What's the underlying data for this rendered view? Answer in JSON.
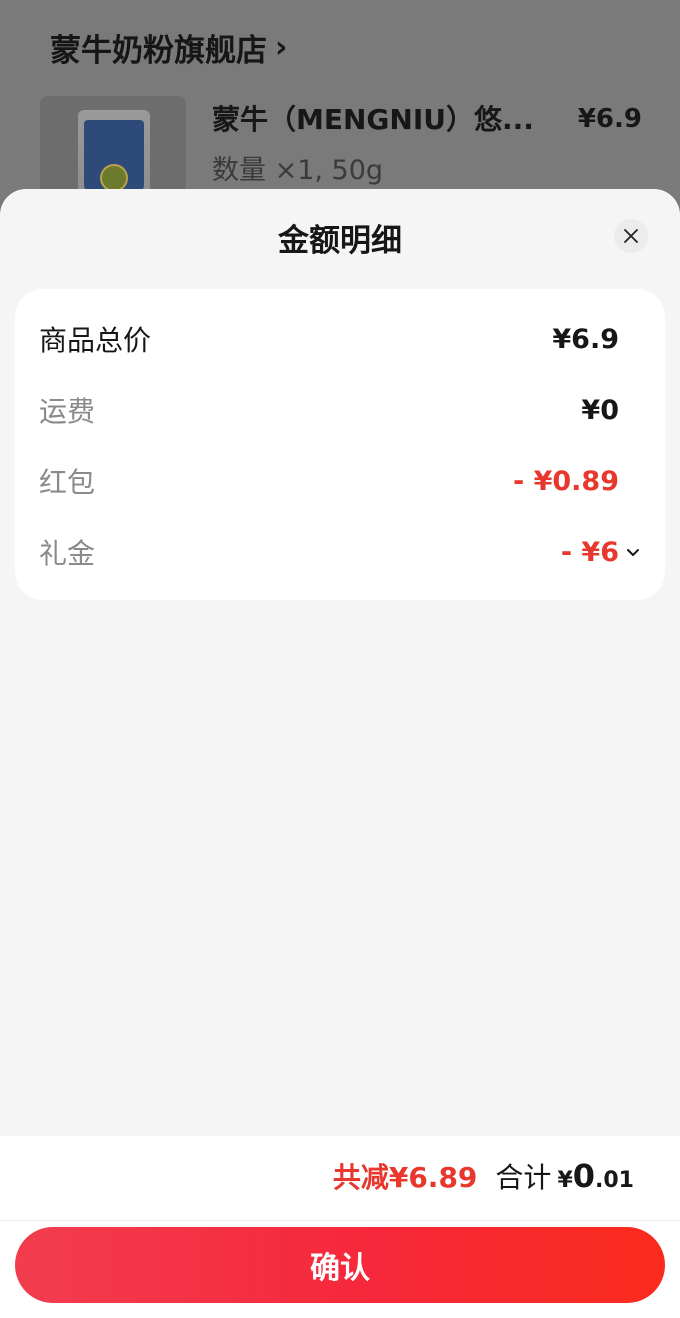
{
  "background_page": {
    "store_name": "蒙牛奶粉旗舰店",
    "product": {
      "title": "蒙牛（MENGNIU）悠...",
      "price": "¥6.9",
      "meta": "数量 ×1, 50g"
    }
  },
  "sheet": {
    "title": "金额明细",
    "rows": [
      {
        "label": "商品总价",
        "value": "¥6.9"
      },
      {
        "label": "运费",
        "value": "¥0"
      },
      {
        "label": "红包",
        "value": "- ¥0.89"
      },
      {
        "label": "礼金",
        "value": "- ¥6"
      }
    ]
  },
  "footer": {
    "saved_label": "共减",
    "saved_amount": "¥6.89",
    "total_label": "合计",
    "total_yen": "¥",
    "total_int": "0",
    "total_dec": ".01",
    "confirm_label": "确认"
  },
  "colors": {
    "accent_red": "#e8382e",
    "button_gradient_start": "#f23d4f",
    "button_gradient_end": "#fa2b1c"
  }
}
